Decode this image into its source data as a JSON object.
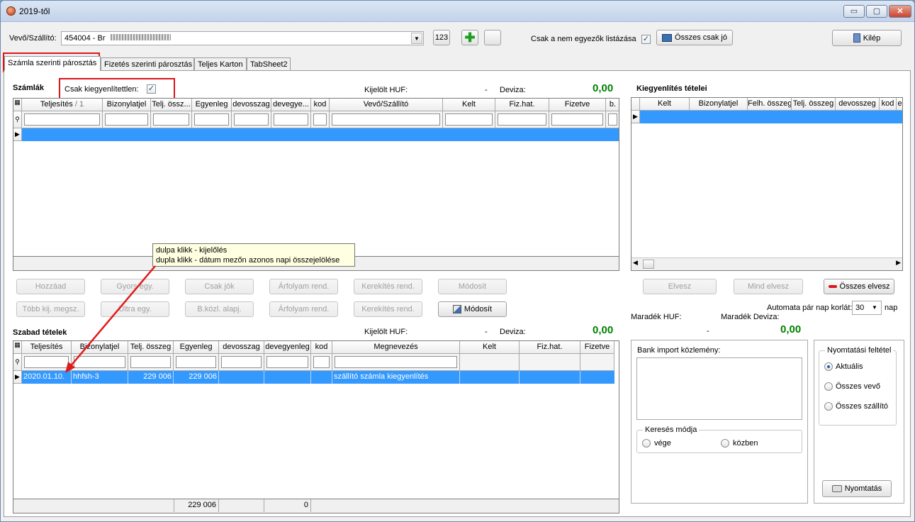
{
  "window": {
    "title": "2019-től",
    "min": "▭",
    "max": "▢",
    "close": "✕"
  },
  "top": {
    "partner_label": "Vevő/Szállító:",
    "partner_value": "454004 - Br",
    "num_button": "123",
    "only_mismatch_label": "Csak a nem egyezők listázása",
    "all_ok_button": "Összes csak jó",
    "exit_button": "Kilép"
  },
  "tabs": [
    "Számla szerinti párosztás",
    "Fizetés szerinti párosztás",
    "Teljes Karton",
    "TabSheet2"
  ],
  "invoices": {
    "title": "Számlák",
    "only_unsettled_label": "Csak kiegyenlítettlen:",
    "selected_huf_label": "Kijelölt HUF:",
    "selected_huf_value": "-",
    "currency_label": "Deviza:",
    "currency_value": "0,00",
    "columns": [
      "Teljesítés",
      "Bizonylatjel",
      "Telj. össz...",
      "Egyenleg",
      "devosszag",
      "devegye...",
      "kod",
      "Vevő/Szállító",
      "Kelt",
      "Fiz.hat.",
      "Fizetve",
      "b."
    ],
    "sort_marker": "/ 1"
  },
  "tooltip": {
    "line1": "dulpa klikk - kijelőlés",
    "line2": "dupla klikk - dátum mezőn azonos napi összejelölése"
  },
  "buttons_row1": [
    "Hozzáad",
    "Gyors egy.",
    "Csak jók",
    "Árfolyam rend.",
    "Kerekítés rend.",
    "Módosít"
  ],
  "buttons_row2": [
    "Több kij. megsz.",
    "Ultra egy.",
    "B.közl. alapj.",
    "Árfolyam rend.",
    "Kerekítés rend.",
    "Módosít"
  ],
  "free_items": {
    "title": "Szabad tételek",
    "selected_huf_label": "Kijelölt HUF:",
    "selected_huf_value": "-",
    "currency_label": "Deviza:",
    "currency_value": "0,00",
    "columns": [
      "Teljesítés",
      "Bizonylatjel",
      "Telj. összeg",
      "Egyenleg",
      "devosszag",
      "devegyenleg",
      "kod",
      "Megnevezés",
      "Kelt",
      "Fiz.hat.",
      "Fizetve"
    ],
    "row": {
      "date": "2020.01.10.",
      "doc": "hhfsh-3",
      "total": "229 006",
      "balance": "229 006",
      "desc": "szállító számla kiegyenlítés"
    },
    "footer": {
      "total": "229 006",
      "devbalance": "0"
    }
  },
  "settlement": {
    "title": "Kiegyenlítés tételei",
    "columns": [
      "Kelt",
      "Bizonylatjel",
      "Felh. összeg",
      "Telj. összeg",
      "devosszeg",
      "kod",
      "e"
    ],
    "remove_button": "Elvesz",
    "remove_all_button": "Mind elvesz",
    "remove_total_button": "Összes elvesz",
    "auto_pair_label": "Automata pár nap korlát:",
    "auto_pair_value": "30",
    "auto_pair_unit": "nap",
    "remaining_huf_label": "Maradék HUF:",
    "remaining_currency_label": "Maradék Deviza:",
    "remaining_huf_value": "-",
    "remaining_currency_value": "0,00"
  },
  "bank": {
    "label": "Bank import közlemény:",
    "search_mode_title": "Keresés módja",
    "search_end": "vége",
    "search_in": "közben"
  },
  "print": {
    "title": "Nyomtatási feltétel",
    "opt_current": "Aktuális",
    "opt_all_customer": "Összes vevő",
    "opt_all_supplier": "Összes szállító",
    "button": "Nyomtatás"
  },
  "colors": {
    "selection": "#3399ff",
    "highlight": "#d9161c",
    "green": "#008000"
  }
}
